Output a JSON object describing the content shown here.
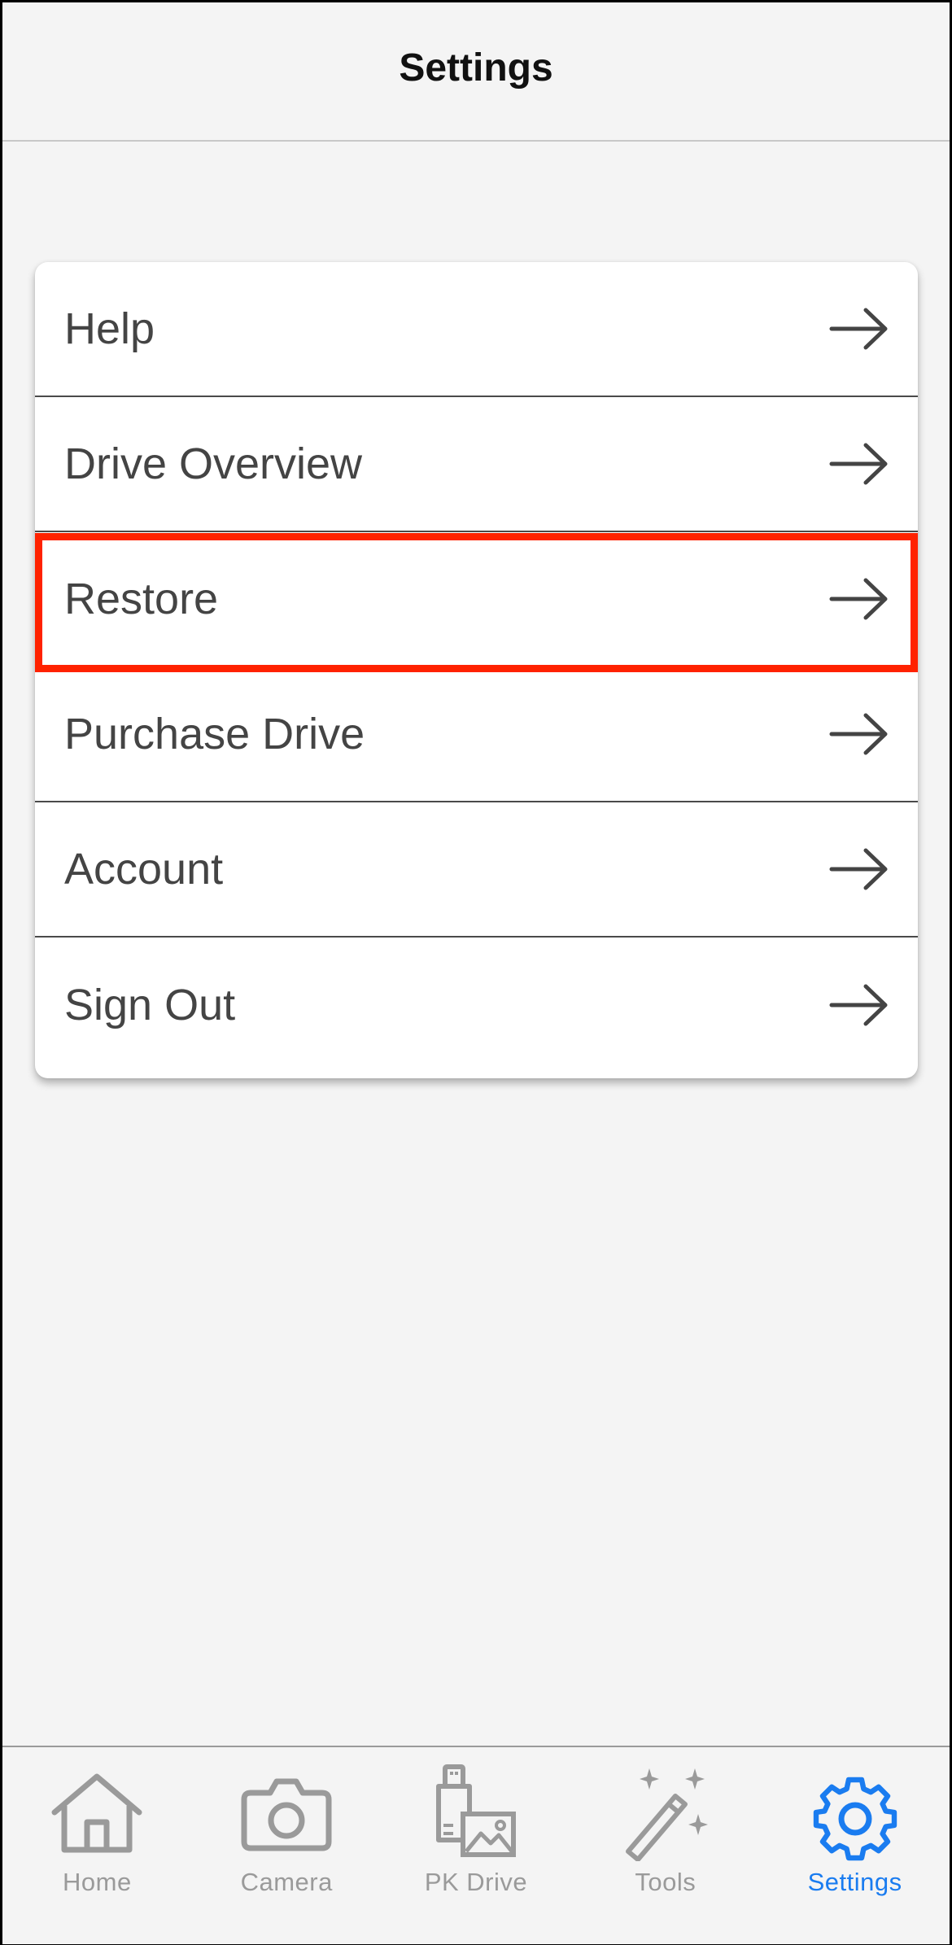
{
  "header": {
    "title": "Settings"
  },
  "menu": {
    "items": [
      {
        "label": "Help",
        "icon": "arrow-right-icon"
      },
      {
        "label": "Drive Overview",
        "icon": "arrow-right-icon"
      },
      {
        "label": "Restore",
        "icon": "arrow-right-icon",
        "highlighted": true
      },
      {
        "label": "Purchase Drive",
        "icon": "arrow-right-icon"
      },
      {
        "label": "Account",
        "icon": "arrow-right-icon"
      },
      {
        "label": "Sign Out",
        "icon": "arrow-right-icon"
      }
    ]
  },
  "tab_bar": {
    "tabs": [
      {
        "label": "Home",
        "icon": "home-icon",
        "active": false
      },
      {
        "label": "Camera",
        "icon": "camera-icon",
        "active": false
      },
      {
        "label": "PK Drive",
        "icon": "drive-photo-icon",
        "active": false
      },
      {
        "label": "Tools",
        "icon": "magic-wand-icon",
        "active": false
      },
      {
        "label": "Settings",
        "icon": "gear-icon",
        "active": true
      }
    ]
  },
  "colors": {
    "background": "#f4f4f4",
    "card": "#ffffff",
    "text": "#444444",
    "inactive_tab": "#9a9a9a",
    "active_tab": "#1a7cf0",
    "highlight": "#ff2200"
  }
}
